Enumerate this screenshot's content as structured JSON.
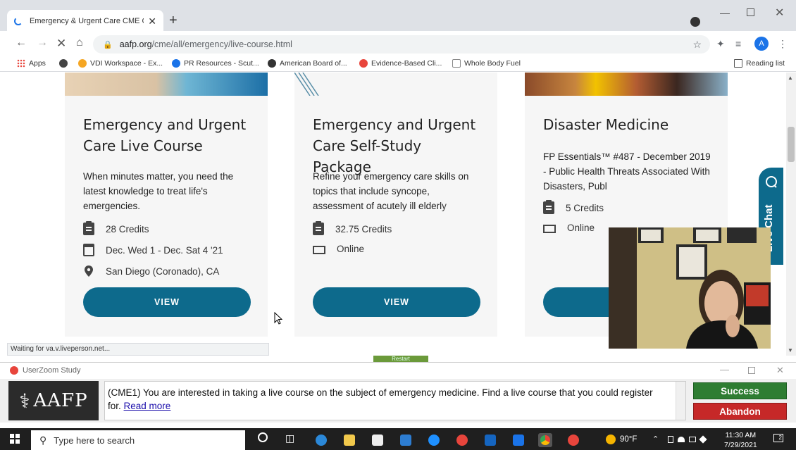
{
  "browser": {
    "tab_title": "Emergency & Urgent Care CME C",
    "tab_close": "✕",
    "new_tab": "+",
    "url_host": "aafp.org",
    "url_path": "/cme/all/emergency/live-course.html",
    "avatar_letter": "A",
    "bookmarks": [
      {
        "label": "Apps",
        "icon": "apps-grid-icon",
        "color": "#e8453c"
      },
      {
        "label": "",
        "icon": "globe-icon",
        "color": "#333333"
      },
      {
        "label": "VDI Workspace - Ex...",
        "icon": "vdi-icon",
        "color": "#f5a623"
      },
      {
        "label": "PR Resources - Scut...",
        "icon": "pr-icon",
        "color": "#1a73e8"
      },
      {
        "label": "American Board of...",
        "icon": "abfm-icon",
        "color": "#333333"
      },
      {
        "label": "Evidence-Based Cli...",
        "icon": "ebm-icon",
        "color": "#e8453c"
      },
      {
        "label": "Whole Body Fuel",
        "icon": "fork-icon",
        "color": "#888888"
      }
    ],
    "reading_list": "Reading list",
    "status_text": "Waiting for va.v.liveperson.net..."
  },
  "cards": [
    {
      "title": "Emergency and Urgent Care Live Course",
      "description": "When minutes matter, you need the latest knowledge to treat life's emergencies.",
      "credits": "28 Credits",
      "dates": "Dec. Wed 1 - Dec. Sat 4 '21",
      "location": "San Diego (Coronado), CA",
      "button": "VIEW"
    },
    {
      "title": "Emergency and Urgent Care Self-Study Package",
      "description": "Refine your emergency care skills on topics that include syncope, assessment of acutely ill elderly",
      "credits": "32.75 Credits",
      "format": "Online",
      "button": "VIEW"
    },
    {
      "title": "Disaster Medicine",
      "description": "FP Essentials™ #487 - December 2019 - Public Health Threats Associated With Disasters, Publ",
      "credits": "5 Credits",
      "format": "Online",
      "button": "VIEW"
    }
  ],
  "live_chat": "Live Chat",
  "restart_label": "Restart",
  "userzoom": {
    "title": "UserZoom Study",
    "logo": "AAFP",
    "task_text": "(CME1) You are interested in taking a live course on the subject of emergency medicine. Find a live course that you could register for.",
    "read_more": "Read more",
    "success": "Success",
    "abandon": "Abandon"
  },
  "taskbar": {
    "search_placeholder": "Type here to search",
    "weather": "90°F",
    "time": "11:30 AM",
    "date": "7/29/2021",
    "notifications": "2"
  },
  "colors": {
    "brand_teal": "#0d6a8c",
    "success": "#2e7d32",
    "abandon": "#c62828"
  }
}
